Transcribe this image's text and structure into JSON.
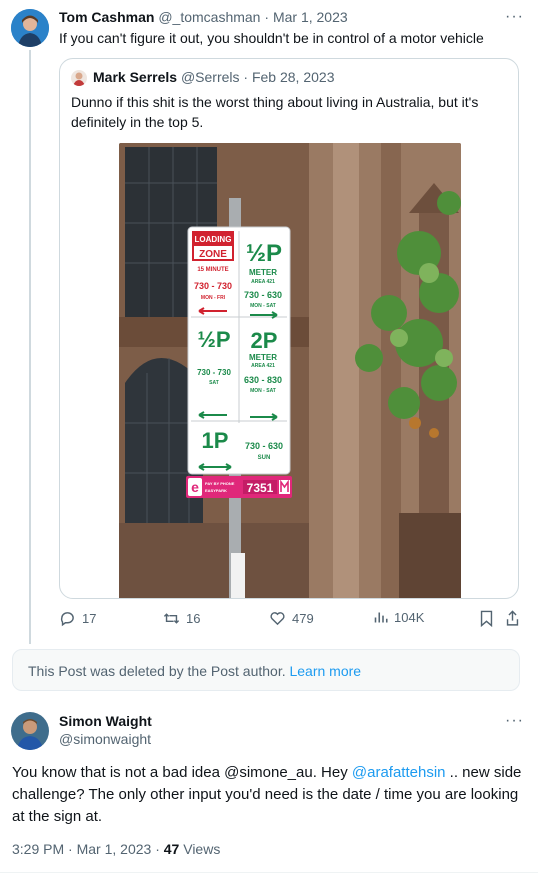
{
  "post1": {
    "author": "Tom Cashman",
    "handle": "@_tomcashman",
    "sep": "·",
    "date": "Mar 1, 2023",
    "text": "If you can't figure it out, you shouldn't be in control of a motor vehicle",
    "more": "···"
  },
  "quote": {
    "author": "Mark Serrels",
    "handle": "@Serrels",
    "sep": "·",
    "date": "Feb 28, 2023",
    "text": "Dunno if this shit is the worst thing about living in Australia, but it's definitely in the top 5.",
    "sign": {
      "loading": "LOADING",
      "zone": "ZONE",
      "minutes": "15 MINUTE",
      "lz_time": "730 - 730",
      "lz_days": "MON - FRI",
      "half_p": "½P",
      "meter": "METER",
      "area": "AREA 421",
      "half_time": "730 - 630",
      "half_days": "MON - SAT",
      "half_p2": "½P",
      "half2_time": "730 - 730",
      "half2_days": "SAT",
      "two_p": "2P",
      "meter2": "METER",
      "area2": "AREA 421",
      "two_time": "630 - 830",
      "two_days": "MON - SAT",
      "one_p": "1P",
      "one_time": "730 - 630",
      "one_days": "SUN",
      "pay": "PAY BY PHONE",
      "easy": "EASYPARK",
      "zone_num": "7351",
      "easy_logo": "e"
    }
  },
  "actions": {
    "replies": "17",
    "retweets": "16",
    "likes": "479",
    "views": "104K"
  },
  "deleted": {
    "text": "This Post was deleted by the Post author.",
    "link": "Learn more"
  },
  "post2": {
    "author": "Simon Waight",
    "handle": "@simonwaight",
    "more": "···",
    "text_1": "You know that is not a bad idea @simone_au. Hey ",
    "mention": "@arafattehsin",
    "text_2": " .. new side challenge? The only other input you'd need is the date / time you are looking at the sign at.",
    "time": "3:29 PM",
    "sep": "·",
    "date": "Mar 1, 2023",
    "sep2": "·",
    "views": "47",
    "views_label": "Views"
  },
  "colors": {
    "accent": "#1d9bf0",
    "muted": "#536471",
    "sign_red": "#d1222f",
    "sign_green": "#1b8a4a",
    "easypark_pink": "#e0287a"
  }
}
